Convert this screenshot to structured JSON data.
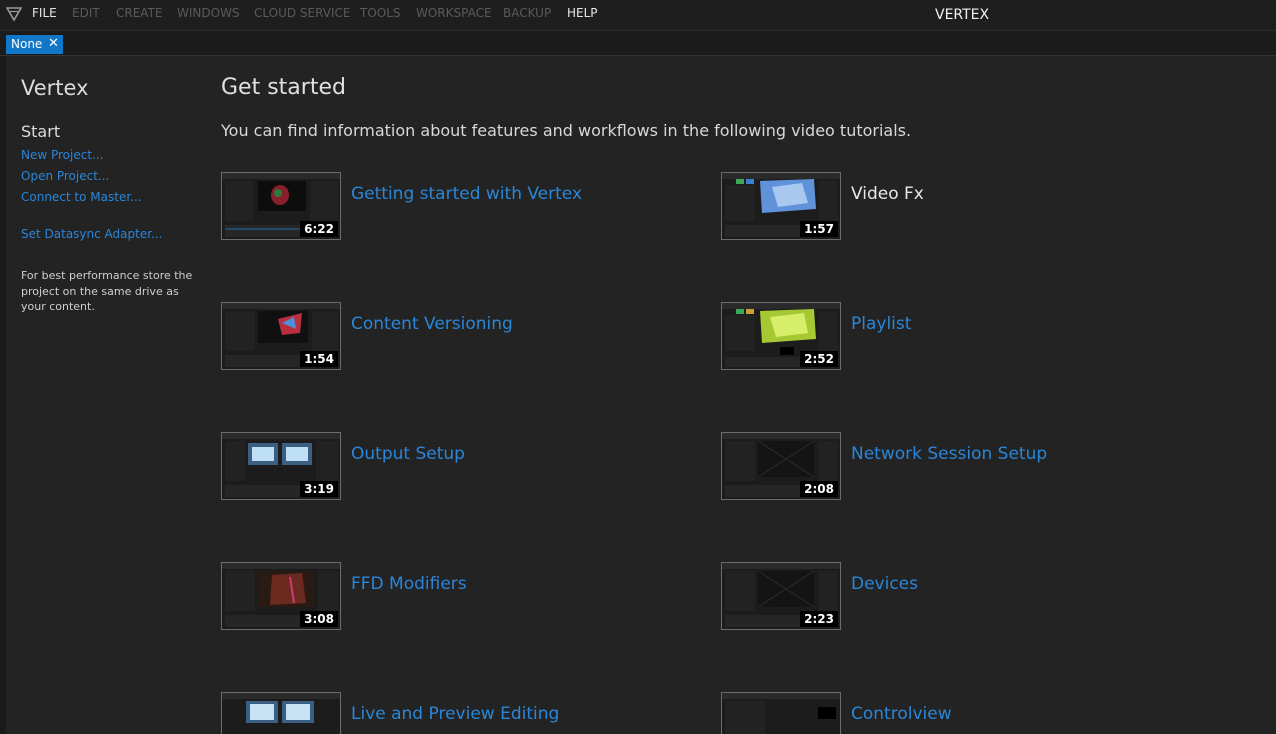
{
  "menubar": {
    "items": [
      {
        "label": "FILE",
        "active": true
      },
      {
        "label": "EDIT",
        "active": false
      },
      {
        "label": "CREATE",
        "active": false
      },
      {
        "label": "WINDOWS",
        "active": false
      },
      {
        "label": "CLOUD SERVICE",
        "active": false
      },
      {
        "label": "TOOLS",
        "active": false
      },
      {
        "label": "WORKSPACE",
        "active": false
      },
      {
        "label": "BACKUP",
        "active": false
      },
      {
        "label": "HELP",
        "active": true
      }
    ],
    "app_title": "VERTEX"
  },
  "tabs": {
    "active_label": "None",
    "close_glyph": "✕"
  },
  "sidebar": {
    "title": "Vertex",
    "section": "Start",
    "links": [
      "New Project...",
      "Open Project...",
      "Connect to Master...",
      "Set Datasync Adapter..."
    ],
    "note": "For best performance store the project on the same drive as your content."
  },
  "main": {
    "title": "Get started",
    "description": "You can find information about features and workflows in the following video tutorials.",
    "videos": [
      {
        "title": "Getting started with Vertex",
        "duration": "6:22",
        "visited": false
      },
      {
        "title": "Video Fx",
        "duration": "1:57",
        "visited": true
      },
      {
        "title": "Content Versioning",
        "duration": "1:54",
        "visited": false
      },
      {
        "title": "Playlist",
        "duration": "2:52",
        "visited": false
      },
      {
        "title": "Output Setup",
        "duration": "3:19",
        "visited": false
      },
      {
        "title": "Network Session Setup",
        "duration": "2:08",
        "visited": false
      },
      {
        "title": "FFD Modifiers",
        "duration": "3:08",
        "visited": false
      },
      {
        "title": "Devices",
        "duration": "2:23",
        "visited": false
      },
      {
        "title": "Live and Preview Editing",
        "duration": "",
        "visited": false
      },
      {
        "title": "Controlview",
        "duration": "",
        "visited": false
      }
    ]
  },
  "colors": {
    "background": "#232323",
    "accent": "#1177c8",
    "link": "#2a86d9"
  }
}
